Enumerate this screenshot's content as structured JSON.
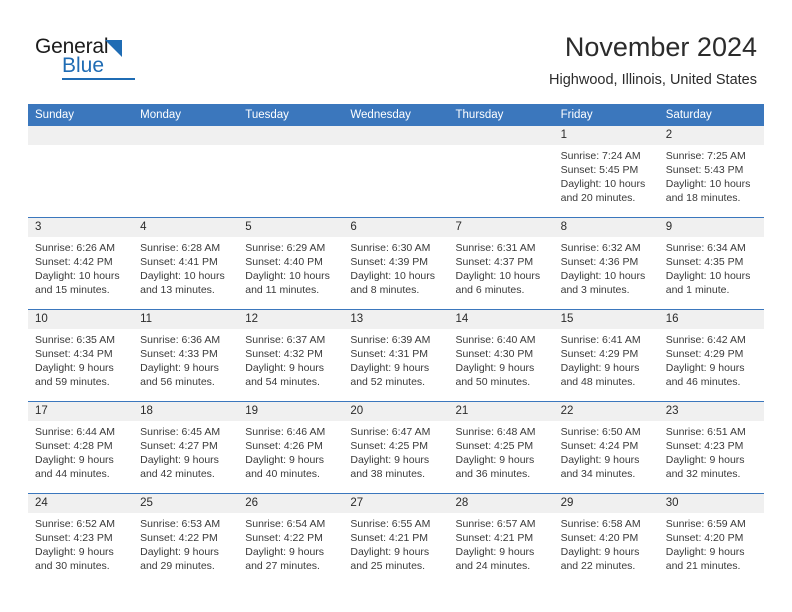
{
  "brand": {
    "name_part1": "General",
    "name_part2": "Blue",
    "accent_color": "#1f6cb4"
  },
  "header": {
    "title": "November 2024",
    "subtitle": "Highwood, Illinois, United States"
  },
  "theme": {
    "header_blue": "#3b77bd",
    "date_band_gray": "#f0f0f0",
    "text_color": "#2b2b2b"
  },
  "weekdays": [
    "Sunday",
    "Monday",
    "Tuesday",
    "Wednesday",
    "Thursday",
    "Friday",
    "Saturday"
  ],
  "weeks": [
    {
      "days": [
        {
          "num": "",
          "lines": []
        },
        {
          "num": "",
          "lines": []
        },
        {
          "num": "",
          "lines": []
        },
        {
          "num": "",
          "lines": []
        },
        {
          "num": "",
          "lines": []
        },
        {
          "num": "1",
          "lines": [
            "Sunrise: 7:24 AM",
            "Sunset: 5:45 PM",
            "Daylight: 10 hours",
            "and 20 minutes."
          ]
        },
        {
          "num": "2",
          "lines": [
            "Sunrise: 7:25 AM",
            "Sunset: 5:43 PM",
            "Daylight: 10 hours",
            "and 18 minutes."
          ]
        }
      ]
    },
    {
      "days": [
        {
          "num": "3",
          "lines": [
            "Sunrise: 6:26 AM",
            "Sunset: 4:42 PM",
            "Daylight: 10 hours",
            "and 15 minutes."
          ]
        },
        {
          "num": "4",
          "lines": [
            "Sunrise: 6:28 AM",
            "Sunset: 4:41 PM",
            "Daylight: 10 hours",
            "and 13 minutes."
          ]
        },
        {
          "num": "5",
          "lines": [
            "Sunrise: 6:29 AM",
            "Sunset: 4:40 PM",
            "Daylight: 10 hours",
            "and 11 minutes."
          ]
        },
        {
          "num": "6",
          "lines": [
            "Sunrise: 6:30 AM",
            "Sunset: 4:39 PM",
            "Daylight: 10 hours",
            "and 8 minutes."
          ]
        },
        {
          "num": "7",
          "lines": [
            "Sunrise: 6:31 AM",
            "Sunset: 4:37 PM",
            "Daylight: 10 hours",
            "and 6 minutes."
          ]
        },
        {
          "num": "8",
          "lines": [
            "Sunrise: 6:32 AM",
            "Sunset: 4:36 PM",
            "Daylight: 10 hours",
            "and 3 minutes."
          ]
        },
        {
          "num": "9",
          "lines": [
            "Sunrise: 6:34 AM",
            "Sunset: 4:35 PM",
            "Daylight: 10 hours",
            "and 1 minute."
          ]
        }
      ]
    },
    {
      "days": [
        {
          "num": "10",
          "lines": [
            "Sunrise: 6:35 AM",
            "Sunset: 4:34 PM",
            "Daylight: 9 hours",
            "and 59 minutes."
          ]
        },
        {
          "num": "11",
          "lines": [
            "Sunrise: 6:36 AM",
            "Sunset: 4:33 PM",
            "Daylight: 9 hours",
            "and 56 minutes."
          ]
        },
        {
          "num": "12",
          "lines": [
            "Sunrise: 6:37 AM",
            "Sunset: 4:32 PM",
            "Daylight: 9 hours",
            "and 54 minutes."
          ]
        },
        {
          "num": "13",
          "lines": [
            "Sunrise: 6:39 AM",
            "Sunset: 4:31 PM",
            "Daylight: 9 hours",
            "and 52 minutes."
          ]
        },
        {
          "num": "14",
          "lines": [
            "Sunrise: 6:40 AM",
            "Sunset: 4:30 PM",
            "Daylight: 9 hours",
            "and 50 minutes."
          ]
        },
        {
          "num": "15",
          "lines": [
            "Sunrise: 6:41 AM",
            "Sunset: 4:29 PM",
            "Daylight: 9 hours",
            "and 48 minutes."
          ]
        },
        {
          "num": "16",
          "lines": [
            "Sunrise: 6:42 AM",
            "Sunset: 4:29 PM",
            "Daylight: 9 hours",
            "and 46 minutes."
          ]
        }
      ]
    },
    {
      "days": [
        {
          "num": "17",
          "lines": [
            "Sunrise: 6:44 AM",
            "Sunset: 4:28 PM",
            "Daylight: 9 hours",
            "and 44 minutes."
          ]
        },
        {
          "num": "18",
          "lines": [
            "Sunrise: 6:45 AM",
            "Sunset: 4:27 PM",
            "Daylight: 9 hours",
            "and 42 minutes."
          ]
        },
        {
          "num": "19",
          "lines": [
            "Sunrise: 6:46 AM",
            "Sunset: 4:26 PM",
            "Daylight: 9 hours",
            "and 40 minutes."
          ]
        },
        {
          "num": "20",
          "lines": [
            "Sunrise: 6:47 AM",
            "Sunset: 4:25 PM",
            "Daylight: 9 hours",
            "and 38 minutes."
          ]
        },
        {
          "num": "21",
          "lines": [
            "Sunrise: 6:48 AM",
            "Sunset: 4:25 PM",
            "Daylight: 9 hours",
            "and 36 minutes."
          ]
        },
        {
          "num": "22",
          "lines": [
            "Sunrise: 6:50 AM",
            "Sunset: 4:24 PM",
            "Daylight: 9 hours",
            "and 34 minutes."
          ]
        },
        {
          "num": "23",
          "lines": [
            "Sunrise: 6:51 AM",
            "Sunset: 4:23 PM",
            "Daylight: 9 hours",
            "and 32 minutes."
          ]
        }
      ]
    },
    {
      "days": [
        {
          "num": "24",
          "lines": [
            "Sunrise: 6:52 AM",
            "Sunset: 4:23 PM",
            "Daylight: 9 hours",
            "and 30 minutes."
          ]
        },
        {
          "num": "25",
          "lines": [
            "Sunrise: 6:53 AM",
            "Sunset: 4:22 PM",
            "Daylight: 9 hours",
            "and 29 minutes."
          ]
        },
        {
          "num": "26",
          "lines": [
            "Sunrise: 6:54 AM",
            "Sunset: 4:22 PM",
            "Daylight: 9 hours",
            "and 27 minutes."
          ]
        },
        {
          "num": "27",
          "lines": [
            "Sunrise: 6:55 AM",
            "Sunset: 4:21 PM",
            "Daylight: 9 hours",
            "and 25 minutes."
          ]
        },
        {
          "num": "28",
          "lines": [
            "Sunrise: 6:57 AM",
            "Sunset: 4:21 PM",
            "Daylight: 9 hours",
            "and 24 minutes."
          ]
        },
        {
          "num": "29",
          "lines": [
            "Sunrise: 6:58 AM",
            "Sunset: 4:20 PM",
            "Daylight: 9 hours",
            "and 22 minutes."
          ]
        },
        {
          "num": "30",
          "lines": [
            "Sunrise: 6:59 AM",
            "Sunset: 4:20 PM",
            "Daylight: 9 hours",
            "and 21 minutes."
          ]
        }
      ]
    }
  ]
}
